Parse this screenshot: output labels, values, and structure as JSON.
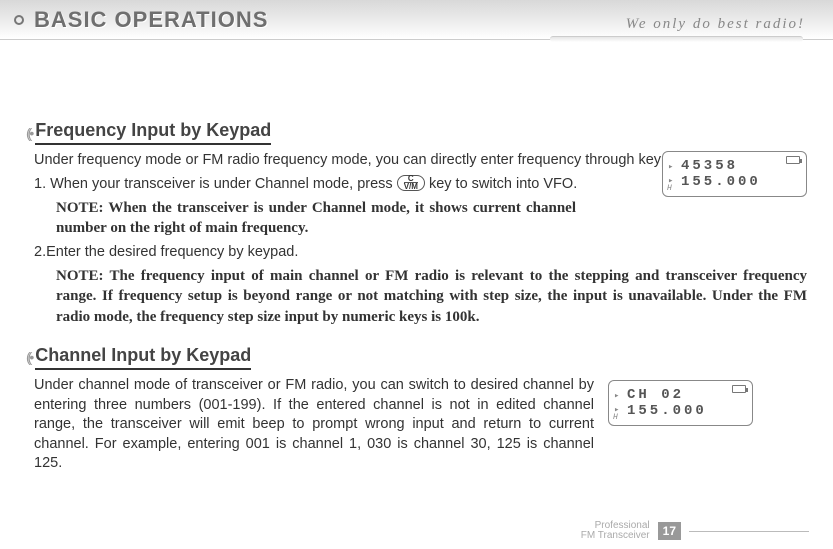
{
  "header": {
    "title": "BASIC OPERATIONS"
  },
  "slogan": "We only do best radio!",
  "section1": {
    "heading": "Frequency Input by Keypad",
    "p1_a": "Under frequency mode or FM radio frequency mode, you can directly enter frequency through keypad.",
    "p1_b_pre": "1. When your transceiver is under Channel mode, press ",
    "p1_b_post": " key to switch into VFO.",
    "key_top": "C",
    "key_bottom": "V/M",
    "note1": "NOTE: When the transceiver is under Channel mode, it shows current channel number on the right of main frequency.",
    "p2": "2.Enter the desired frequency by keypad.",
    "note2": "NOTE: The frequency input of main channel or FM radio is relevant to the stepping and transceiver frequency range. If frequency setup is beyond range or not matching with step size, the input is unavailable. Under the FM radio mode, the frequency step size input by numeric keys is 100k."
  },
  "lcd1": {
    "line1": "45358",
    "line2": "155.000"
  },
  "section2": {
    "heading": "Channel Input by Keypad",
    "p1": "Under channel mode of transceiver or FM radio, you can switch to desired channel by entering three numbers (001-199). If the entered channel is not in edited channel range, the transceiver will emit beep to prompt wrong input and return to current channel. For example, entering 001 is channel 1, 030 is channel 30, 125 is channel 125."
  },
  "lcd2": {
    "line1": "CH 02",
    "line2": "155.000"
  },
  "footer": {
    "line1": "Professional",
    "line2": "FM Transceiver",
    "page": "17"
  }
}
